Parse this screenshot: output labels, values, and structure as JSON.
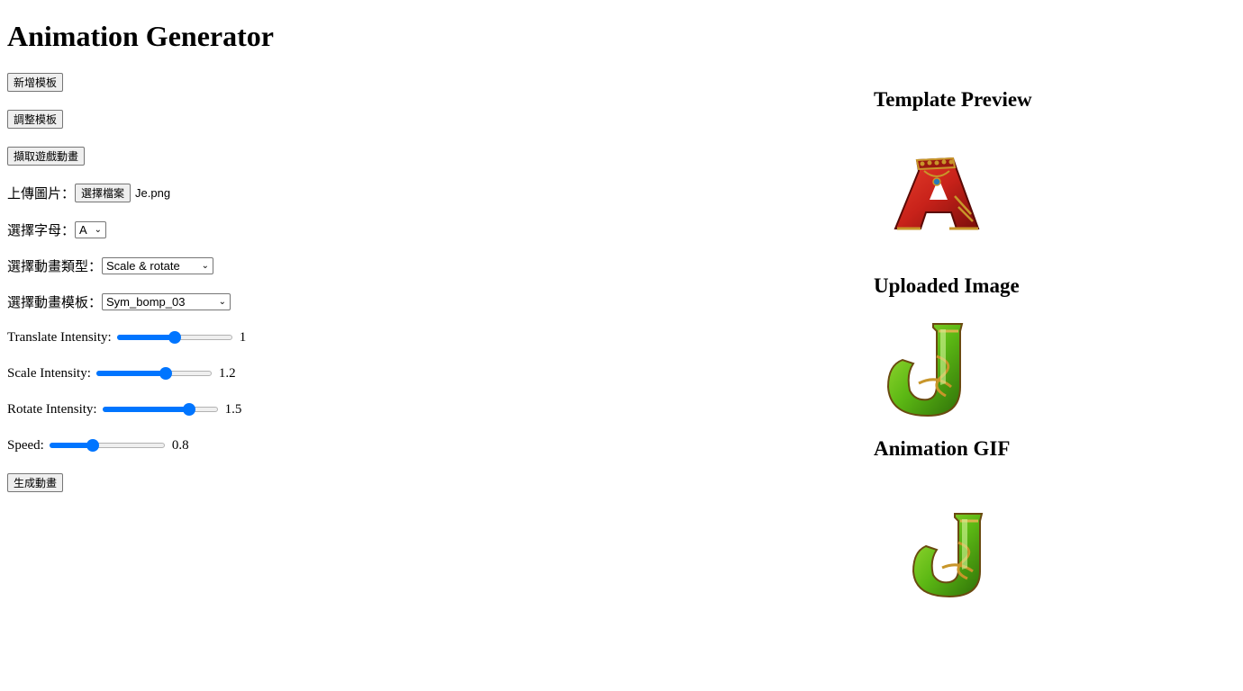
{
  "page": {
    "title": "Animation Generator"
  },
  "controls": {
    "add_template_label": "新增模板",
    "adjust_template_label": "調整模板",
    "capture_animation_label": "擷取遊戲動畫",
    "upload": {
      "label": "上傳圖片：",
      "button_label": "選擇檔案",
      "filename": "Je.png"
    },
    "letter": {
      "label": "選擇字母：",
      "selected": "A"
    },
    "anim_type": {
      "label": "選擇動畫類型：",
      "selected": "Scale & rotate"
    },
    "anim_template": {
      "label": "選擇動畫模板：",
      "selected": "Sym_bomp_03"
    },
    "sliders": [
      {
        "name": "translate",
        "label": "Translate Intensity:",
        "value": "1",
        "fraction": 0.5
      },
      {
        "name": "scale",
        "label": "Scale Intensity:",
        "value": "1.2",
        "fraction": 0.6
      },
      {
        "name": "rotate",
        "label": "Rotate Intensity:",
        "value": "1.5",
        "fraction": 0.75
      },
      {
        "name": "speed",
        "label": "Speed:",
        "value": "0.8",
        "fraction": 0.38
      }
    ],
    "generate_label": "生成動畫"
  },
  "preview": {
    "template_heading": "Template Preview",
    "uploaded_heading": "Uploaded Image",
    "gif_heading": "Animation GIF"
  },
  "colors": {
    "accent": "#0075ff",
    "letter_a_red": "#c8221a",
    "letter_j_green": "#5cb814",
    "gold": "#c8962a"
  },
  "icons": {
    "dropdown": "chevron-down-icon",
    "template_art": "letter-a-red-icon",
    "uploaded_art": "letter-j-green-icon"
  }
}
